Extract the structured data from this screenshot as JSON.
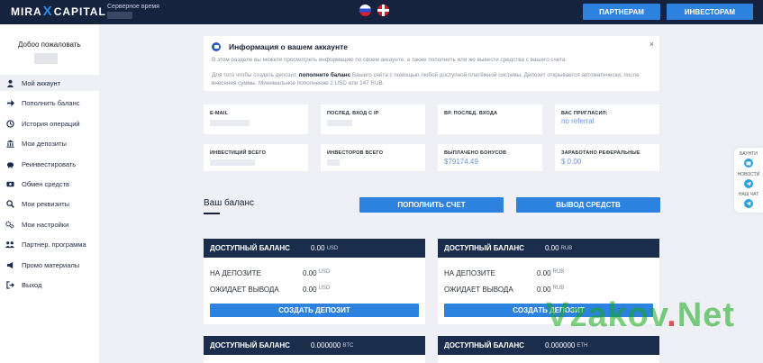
{
  "header": {
    "logo_left": "MIRA",
    "logo_x": "X",
    "logo_right": "CAPITAL",
    "server_time_label": "Серверное время",
    "partners_button": "ПАРТНЕРАМ",
    "investors_button": "ИНВЕСТОРАМ",
    "flags": [
      "flag-ru-icon",
      "flag-gb-icon"
    ]
  },
  "sidebar": {
    "welcome": "Добоо пожаловать",
    "items": [
      {
        "label": "Мой аккаунт",
        "icon": "user-icon"
      },
      {
        "label": "Пополнить баланс",
        "icon": "arrow-right-icon"
      },
      {
        "label": "История операций",
        "icon": "history-icon"
      },
      {
        "label": "Мои депозиты",
        "icon": "bank-icon"
      },
      {
        "label": "Реинвестировать",
        "icon": "piggy-bank-icon"
      },
      {
        "label": "Обмен средств",
        "icon": "exchange-icon"
      },
      {
        "label": "Мои реквизиты",
        "icon": "search-icon"
      },
      {
        "label": "Мои настройки",
        "icon": "gear-icon"
      },
      {
        "label": "Партнер. программа",
        "icon": "partners-icon"
      },
      {
        "label": "Промо материалы",
        "icon": "megaphone-icon"
      },
      {
        "label": "Выход",
        "icon": "logout-icon"
      }
    ]
  },
  "info": {
    "title": "Информация о вашем аккаунте",
    "close": "×",
    "text1": "В этом разделе вы можете просмотреть информацию по своем аккаунте, а также пополнить или же вывести средства с вашего счета.",
    "text2_pre": "Для того чтобы создать депозит, ",
    "text2_bold": "пополните баланс",
    "text2_post": " Вашего счёта с помощью любой доступной платёжной системы. Депозит открывается автоматически, после внесения суммы. Минимальное пополнение 2 USD или 147 RUB."
  },
  "stats": {
    "email_label": "E-MAIL",
    "last_login_ip_label": "ПОСЛЕД. ВХОД С IP",
    "last_login_time_label": "ВР. ПОСЛЕД. ВХОДА",
    "invited_label": "ВАС ПРИГЛАСИЛ:",
    "invited_value": "no referral",
    "investments_label": "ИНВЕСТИЦИЙ ВСЕГО",
    "investors_label": "ИНВЕСТОРОВ ВСЕГО",
    "bonus_label": "ВЫПЛАЧЕНО БОНУСОВ",
    "bonus_value": "$79174.49",
    "referral_label": "ЗАРАБОТАНО РЕФЕРАЛЬНЫЕ",
    "referral_value": "$ 0.00"
  },
  "balance": {
    "title": "Ваш баланс",
    "deposit_button": "ПОПОЛНИТЬ СЧЕТ",
    "withdraw_button": "ВЫВОД СРЕДСТВ",
    "cards": [
      {
        "head_label": "ДОСТУПНЫЙ БАЛАНС",
        "head_value": "0.00",
        "unit": "USD",
        "deposit_label": "НА ДЕПОЗИТЕ",
        "deposit_value": "0.00",
        "pending_label": "ОЖИДАЕТ ВЫВОДА",
        "pending_value": "0.00",
        "button": "СОЗДАТЬ ДЕПОЗИТ"
      },
      {
        "head_label": "ДОСТУПНЫЙ БАЛАНС",
        "head_value": "0.00",
        "unit": "RUB",
        "deposit_label": "НА ДЕПОЗИТЕ",
        "deposit_value": "0.00",
        "pending_label": "ОЖИДАЕТ ВЫВОДА",
        "pending_value": "0.00",
        "button": "СОЗДАТЬ ДЕПОЗИТ"
      },
      {
        "head_label": "ДОСТУПНЫЙ БАЛАНС",
        "head_value": "0.000000",
        "unit": "BTC"
      },
      {
        "head_label": "ДОСТУПНЫЙ БАЛАНС",
        "head_value": "0.000000",
        "unit": "ETH"
      }
    ]
  },
  "widget": {
    "label1": "БАУНТИ",
    "label2": "НОВОСТИ",
    "label3": "НАШ ЧАТ"
  },
  "watermark": {
    "left": "Vzakov",
    "dot": ".",
    "right": "Net"
  },
  "colors": {
    "header_bg": "#15233f",
    "accent": "#2d82e0",
    "card_head": "#1b2d4d",
    "page_bg": "#eef0f5"
  }
}
